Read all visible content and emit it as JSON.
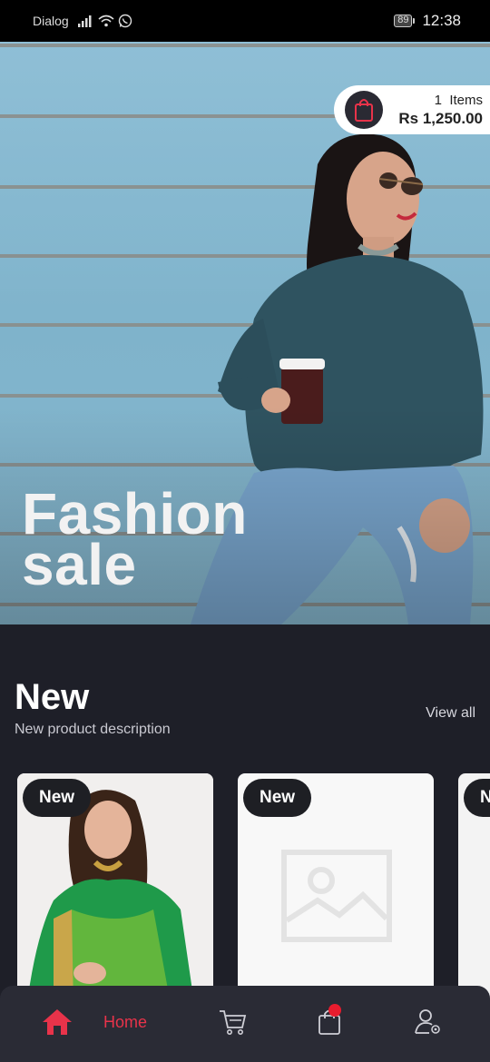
{
  "status_bar": {
    "carrier": "Dialog",
    "battery": "89",
    "time": "12:38",
    "icons": [
      "signal-icon",
      "wifi-icon",
      "whatsapp-icon",
      "battery-icon"
    ]
  },
  "hero": {
    "title_line1": "Fashion",
    "title_line2": "sale",
    "cart": {
      "items_count": "1",
      "items_label": "Items",
      "total": "Rs 1,250.00",
      "icon": "shopping-bag-icon"
    }
  },
  "section": {
    "title": "New",
    "subtitle": "New product description",
    "view_all": "View all"
  },
  "products": [
    {
      "badge": "New",
      "image": "saree-model-photo"
    },
    {
      "badge": "New",
      "image": "image-placeholder-icon"
    },
    {
      "badge": "New",
      "image": "product-photo"
    }
  ],
  "bottom_nav": {
    "home_label": "Home",
    "items": [
      "home-icon",
      "cart-icon",
      "bag-icon",
      "profile-settings-icon"
    ]
  },
  "colors": {
    "accent": "#e8334a",
    "background": "#1e1f28",
    "nav_background": "#2a2b35",
    "badge_dot": "#e81c2e"
  }
}
